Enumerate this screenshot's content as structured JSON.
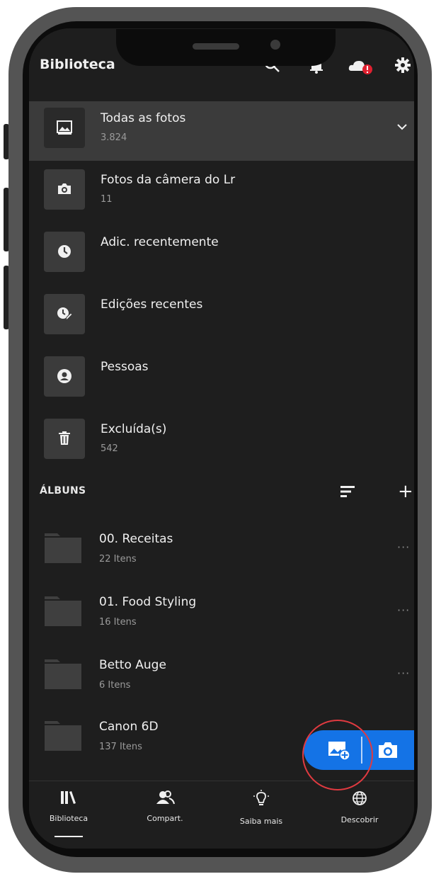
{
  "header": {
    "title": "Biblioteca",
    "icons": [
      "search-icon",
      "bell-icon",
      "cloud-alert-icon",
      "gear-icon"
    ]
  },
  "library": {
    "items": [
      {
        "label": "Todas as fotos",
        "count": "3.824",
        "icon": "photo-icon",
        "selected": true
      },
      {
        "label": "Fotos da câmera do Lr",
        "count": "11",
        "icon": "camera-icon"
      },
      {
        "label": "Adic. recentemente",
        "count": "",
        "icon": "clock-icon"
      },
      {
        "label": "Edições recentes",
        "count": "",
        "icon": "clock-edit-icon"
      },
      {
        "label": "Pessoas",
        "count": "",
        "icon": "person-icon"
      },
      {
        "label": "Excluída(s)",
        "count": "542",
        "icon": "trash-icon"
      }
    ]
  },
  "albums": {
    "section_title": "ÁLBUNS",
    "items": [
      {
        "label": "00. Receitas",
        "count": "22 Itens"
      },
      {
        "label": "01. Food Styling",
        "count": "16 Itens"
      },
      {
        "label": "Betto Auge",
        "count": "6 Itens"
      },
      {
        "label": "Canon 6D",
        "count": "137 Itens"
      }
    ],
    "more": "···"
  },
  "nav": {
    "items": [
      {
        "label": "Biblioteca",
        "icon": "library-icon"
      },
      {
        "label": "Compart.",
        "icon": "share-people-icon"
      },
      {
        "label": "Saiba mais",
        "icon": "lightbulb-icon"
      },
      {
        "label": "Descobrir",
        "icon": "globe-icon"
      }
    ]
  },
  "colors": {
    "accent": "#1473e6",
    "highlight_circle": "#e03a40",
    "background": "#1e1e1e"
  }
}
